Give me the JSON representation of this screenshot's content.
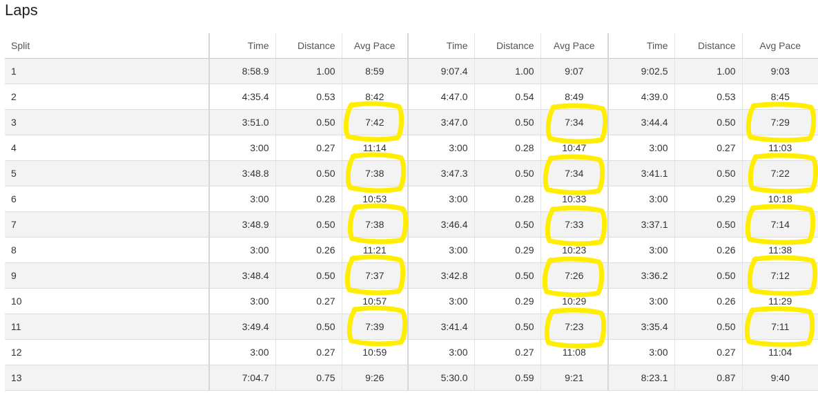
{
  "title": "Laps",
  "headers": [
    "Split",
    "Time",
    "Distance",
    "Avg Pace",
    "Time",
    "Distance",
    "Avg Pace",
    "Time",
    "Distance",
    "Avg Pace"
  ],
  "rows": [
    [
      "1",
      "8:58.9",
      "1.00",
      "8:59",
      "9:07.4",
      "1.00",
      "9:07",
      "9:02.5",
      "1.00",
      "9:03"
    ],
    [
      "2",
      "4:35.4",
      "0.53",
      "8:42",
      "4:47.0",
      "0.54",
      "8:49",
      "4:39.0",
      "0.53",
      "8:45"
    ],
    [
      "3",
      "3:51.0",
      "0.50",
      "7:42",
      "3:47.0",
      "0.50",
      "7:34",
      "3:44.4",
      "0.50",
      "7:29"
    ],
    [
      "4",
      "3:00",
      "0.27",
      "11:14",
      "3:00",
      "0.28",
      "10:47",
      "3:00",
      "0.27",
      "11:03"
    ],
    [
      "5",
      "3:48.8",
      "0.50",
      "7:38",
      "3:47.3",
      "0.50",
      "7:34",
      "3:41.1",
      "0.50",
      "7:22"
    ],
    [
      "6",
      "3:00",
      "0.28",
      "10:53",
      "3:00",
      "0.28",
      "10:33",
      "3:00",
      "0.29",
      "10:18"
    ],
    [
      "7",
      "3:48.9",
      "0.50",
      "7:38",
      "3:46.4",
      "0.50",
      "7:33",
      "3:37.1",
      "0.50",
      "7:14"
    ],
    [
      "8",
      "3:00",
      "0.26",
      "11:21",
      "3:00",
      "0.29",
      "10:23",
      "3:00",
      "0.26",
      "11:38"
    ],
    [
      "9",
      "3:48.4",
      "0.50",
      "7:37",
      "3:42.8",
      "0.50",
      "7:26",
      "3:36.2",
      "0.50",
      "7:12"
    ],
    [
      "10",
      "3:00",
      "0.27",
      "10:57",
      "3:00",
      "0.29",
      "10:29",
      "3:00",
      "0.26",
      "11:29"
    ],
    [
      "11",
      "3:49.4",
      "0.50",
      "7:39",
      "3:41.4",
      "0.50",
      "7:23",
      "3:35.4",
      "0.50",
      "7:11"
    ],
    [
      "12",
      "3:00",
      "0.27",
      "10:59",
      "3:00",
      "0.27",
      "11:08",
      "3:00",
      "0.27",
      "11:04"
    ],
    [
      "13",
      "7:04.7",
      "0.75",
      "9:26",
      "5:30.0",
      "0.59",
      "9:21",
      "8:23.1",
      "0.87",
      "9:40"
    ]
  ],
  "highlight": {
    "color": "#ffee00",
    "rows": [
      3,
      5,
      7,
      9,
      11
    ],
    "columns": [
      3,
      6,
      9
    ]
  }
}
